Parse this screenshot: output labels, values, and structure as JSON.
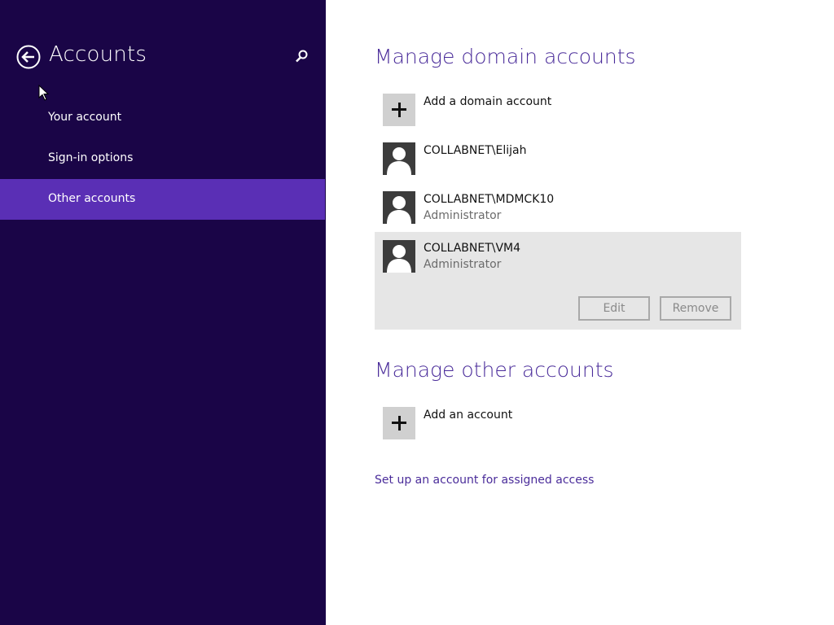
{
  "sidebar": {
    "title": "Accounts",
    "back_icon": "back-arrow-icon",
    "search_icon": "search-icon",
    "items": [
      {
        "label": "Your account",
        "selected": false
      },
      {
        "label": "Sign-in options",
        "selected": false
      },
      {
        "label": "Other accounts",
        "selected": true
      }
    ],
    "colors": {
      "background": "#1a0547",
      "selected": "#5a2fb5"
    }
  },
  "domain_section": {
    "title": "Manage domain accounts",
    "add_label": "Add a domain account",
    "accounts": [
      {
        "name": "COLLABNET\\Elijah",
        "role": ""
      },
      {
        "name": "COLLABNET\\MDMCK10",
        "role": "Administrator"
      },
      {
        "name": "COLLABNET\\VM4",
        "role": "Administrator",
        "selected": true
      }
    ],
    "edit_label": "Edit",
    "remove_label": "Remove"
  },
  "other_section": {
    "title": "Manage other accounts",
    "add_label": "Add an account"
  },
  "assigned_access_link": "Set up an account for assigned access",
  "colors": {
    "accent_text": "#4a2c9a",
    "card_selected": "#e6e6e6"
  }
}
